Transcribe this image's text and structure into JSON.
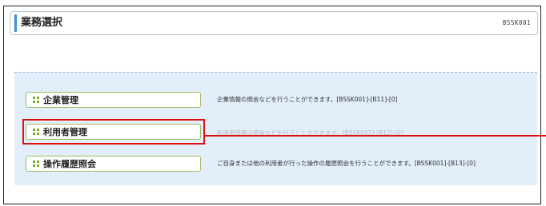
{
  "header": {
    "title": "業務選択",
    "screen_id": "BSSK001"
  },
  "menu": {
    "items": [
      {
        "label": "企業管理",
        "description": "企業情報の照会などを行うことができます。[BSSK001]-[B11]-[0]"
      },
      {
        "label": "利用者管理",
        "description": "利用者情報の照会などを行うことができます。[BSSK001]-[B12]-[0]"
      },
      {
        "label": "操作履歴照会",
        "description": "ご自身または他の利用者が行った操作の履歴照会を行うことができます。[BSSK001]-[B13]-[0]"
      }
    ]
  },
  "colors": {
    "accent": "#3b8fd9",
    "panel_background": "#e2eefa",
    "button_border": "#9ebc62",
    "bullet": "#7fa92f",
    "highlight": "#e01010"
  },
  "icons": {
    "button_bullet": "grid-dots-icon"
  }
}
